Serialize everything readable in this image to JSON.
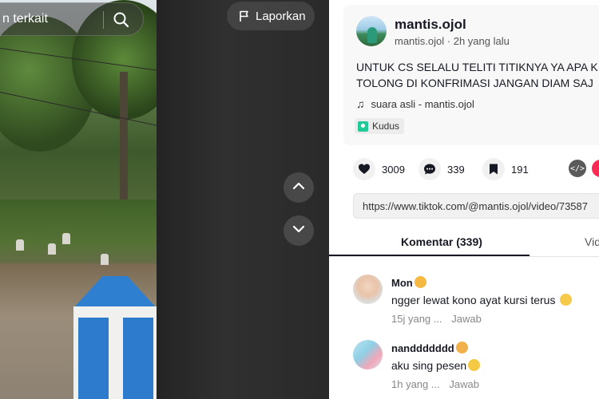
{
  "search": {
    "text": "n terkait"
  },
  "report_button": {
    "label": "Laporkan"
  },
  "post": {
    "username": "mantis.ojol",
    "handle": "mantis.ojol",
    "separator": "·",
    "time": "2h yang lalu",
    "caption_line1": "UNTUK CS SELALU TELITI TITIKNYA YA APA K",
    "caption_line2": "TOLONG DI KONFRIMASI JANGAN DIAM SAJ",
    "music": "suara asli - mantis.ojol",
    "location": "Kudus"
  },
  "stats": {
    "likes": "3009",
    "comments": "339",
    "saves": "191"
  },
  "link": "https://www.tiktok.com/@mantis.ojol/video/73587",
  "tabs": {
    "comments": "Komentar (339)",
    "videos": "Vid"
  },
  "comments": [
    {
      "name": "Mon",
      "text": "ngger lewat kono ayat kursi terus",
      "time": "15j yang ...",
      "reply": "Jawab"
    },
    {
      "name": "nanddddddd",
      "text": "aku sing pesen",
      "time": "1h yang ...",
      "reply": "Jawab"
    }
  ],
  "colors": {
    "accent": "#fe2c55",
    "location_pin": "#20c997",
    "pillar_blue": "#2d7bcc"
  },
  "icons": [
    "search-icon",
    "flag-icon",
    "chevron-up-icon",
    "chevron-down-icon",
    "music-note-icon",
    "location-pin-icon",
    "heart-icon",
    "comment-icon",
    "bookmark-icon",
    "embed-icon",
    "share-icon"
  ]
}
